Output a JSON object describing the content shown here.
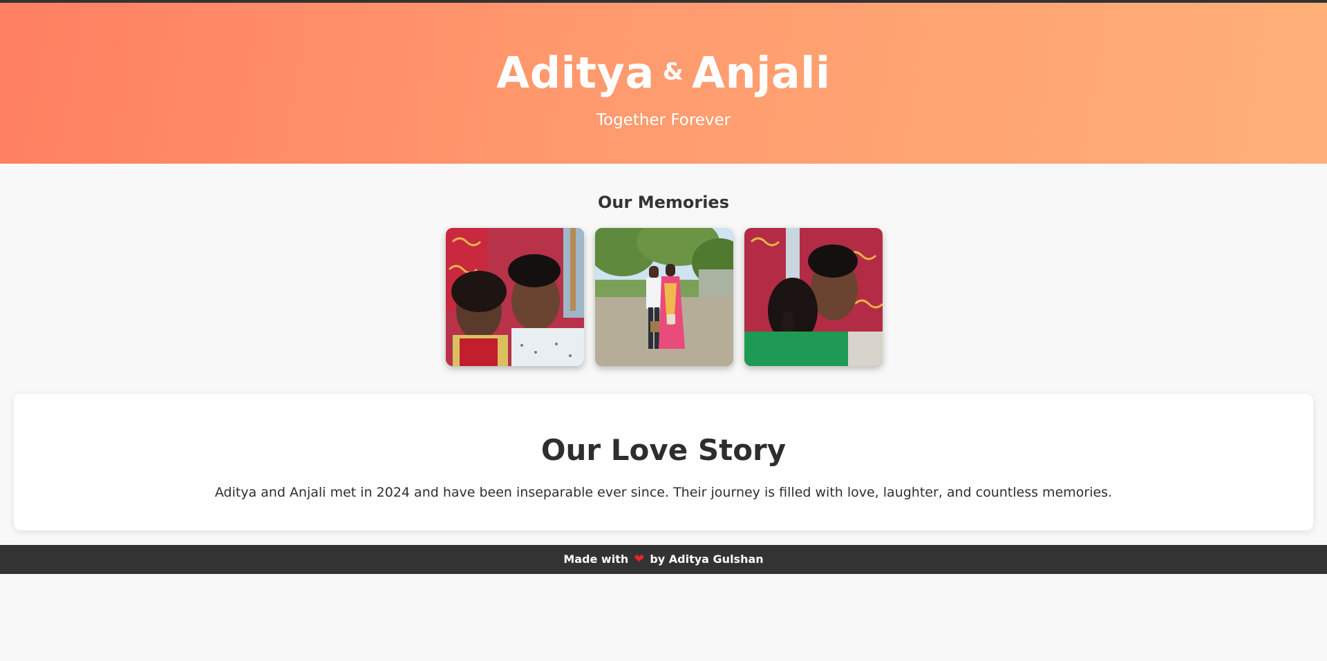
{
  "hero": {
    "name_left": "Aditya",
    "ampersand": "&",
    "name_right": "Anjali",
    "subtitle": "Together Forever",
    "gradient_start": "#ff7f62",
    "gradient_end": "#ffb079"
  },
  "memories": {
    "title": "Our Memories",
    "photos": [
      {
        "description": "couple-selfie-indoor"
      },
      {
        "description": "couple-standing-outdoor"
      },
      {
        "description": "couple-embrace-selfie"
      }
    ]
  },
  "story": {
    "title": "Our Love Story",
    "text": "Aditya and Anjali met in 2024 and have been inseparable ever since. Their journey is filled with love, laughter, and countless memories."
  },
  "footer": {
    "prefix": "Made with",
    "icon": "heart-icon",
    "suffix": "by Aditya Gulshan",
    "heart_color": "#e0262b"
  }
}
